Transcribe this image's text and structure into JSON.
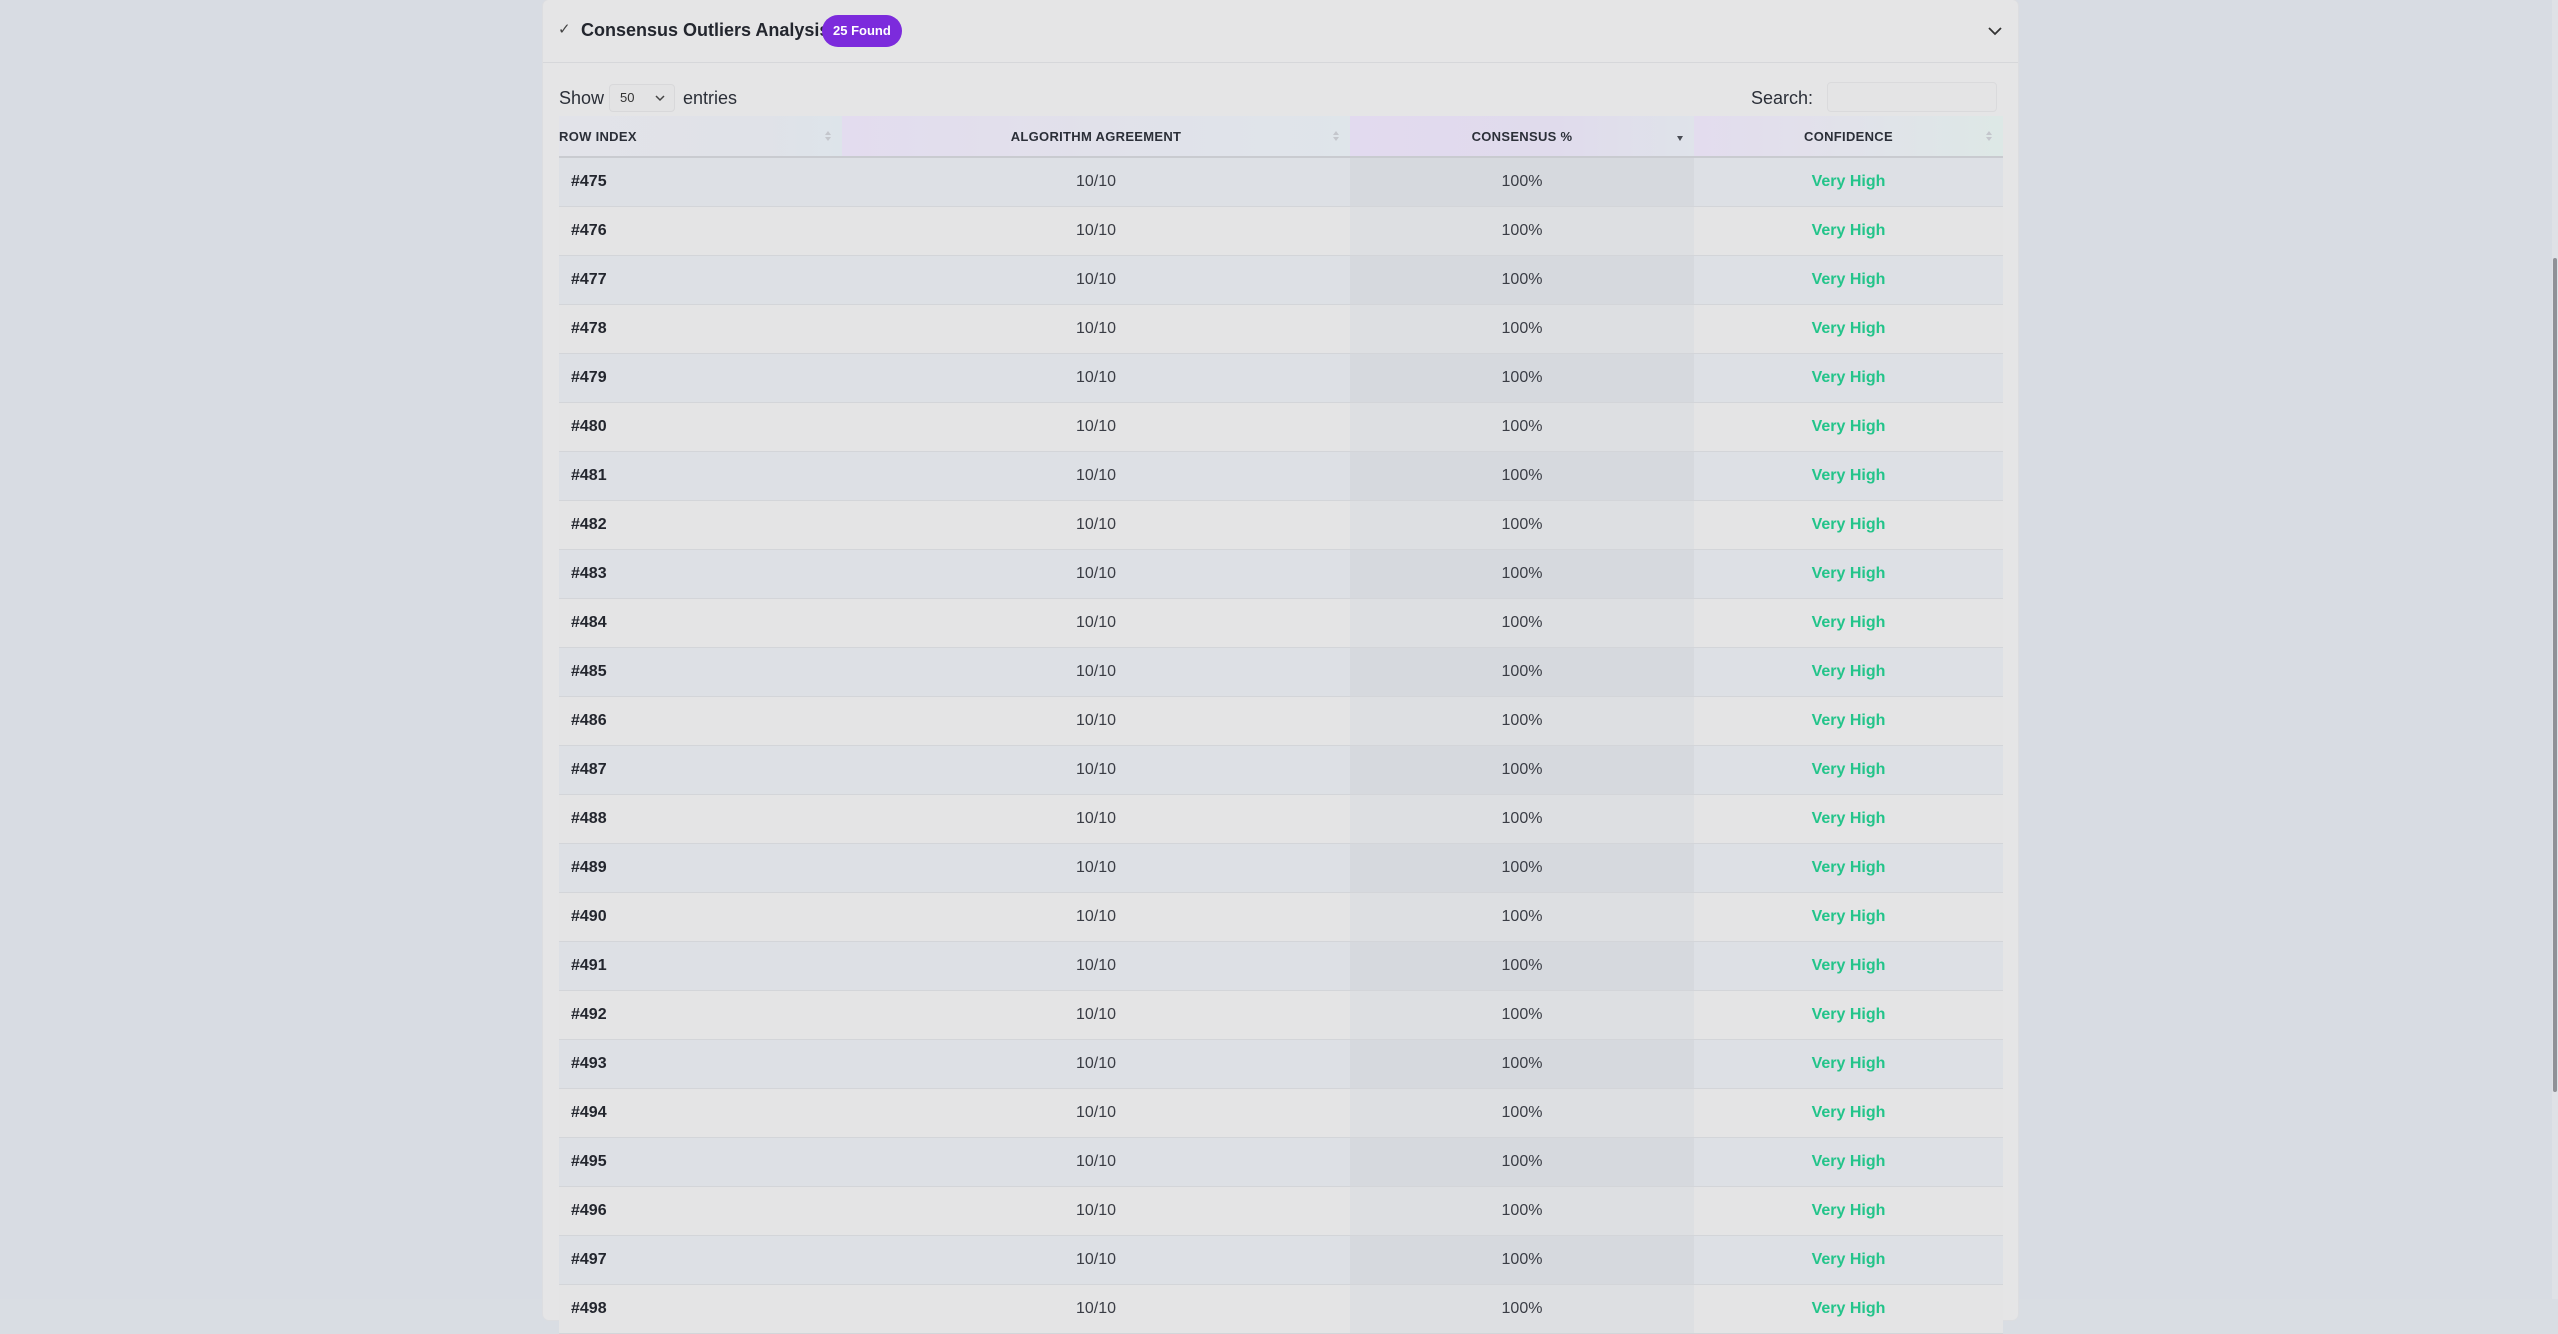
{
  "section": {
    "title": "Consensus Outliers Analysis",
    "badge": "25 Found"
  },
  "controls": {
    "show_label": "Show",
    "entries_value": "50",
    "entries_label": "entries",
    "search_label": "Search:",
    "search_value": ""
  },
  "table": {
    "headers": [
      "ROW INDEX",
      "ALGORITHM AGREEMENT",
      "CONSENSUS %",
      "CONFIDENCE"
    ],
    "sorted_column": "CONSENSUS %",
    "rows": [
      [
        "#475",
        "10/10",
        "100%",
        "Very High"
      ],
      [
        "#476",
        "10/10",
        "100%",
        "Very High"
      ],
      [
        "#477",
        "10/10",
        "100%",
        "Very High"
      ],
      [
        "#478",
        "10/10",
        "100%",
        "Very High"
      ],
      [
        "#479",
        "10/10",
        "100%",
        "Very High"
      ],
      [
        "#480",
        "10/10",
        "100%",
        "Very High"
      ],
      [
        "#481",
        "10/10",
        "100%",
        "Very High"
      ],
      [
        "#482",
        "10/10",
        "100%",
        "Very High"
      ],
      [
        "#483",
        "10/10",
        "100%",
        "Very High"
      ],
      [
        "#484",
        "10/10",
        "100%",
        "Very High"
      ],
      [
        "#485",
        "10/10",
        "100%",
        "Very High"
      ],
      [
        "#486",
        "10/10",
        "100%",
        "Very High"
      ],
      [
        "#487",
        "10/10",
        "100%",
        "Very High"
      ],
      [
        "#488",
        "10/10",
        "100%",
        "Very High"
      ],
      [
        "#489",
        "10/10",
        "100%",
        "Very High"
      ],
      [
        "#490",
        "10/10",
        "100%",
        "Very High"
      ],
      [
        "#491",
        "10/10",
        "100%",
        "Very High"
      ],
      [
        "#492",
        "10/10",
        "100%",
        "Very High"
      ],
      [
        "#493",
        "10/10",
        "100%",
        "Very High"
      ],
      [
        "#494",
        "10/10",
        "100%",
        "Very High"
      ],
      [
        "#495",
        "10/10",
        "100%",
        "Very High"
      ],
      [
        "#496",
        "10/10",
        "100%",
        "Very High"
      ],
      [
        "#497",
        "10/10",
        "100%",
        "Very High"
      ],
      [
        "#498",
        "10/10",
        "100%",
        "Very High"
      ]
    ]
  },
  "colors": {
    "badge": "#7c2bdc",
    "confidence_text": "#23c48a"
  },
  "icons": {
    "section_icon": "check-icon",
    "collapse_icon": "chevron-down-icon",
    "sort_icon": "sort-icon"
  }
}
